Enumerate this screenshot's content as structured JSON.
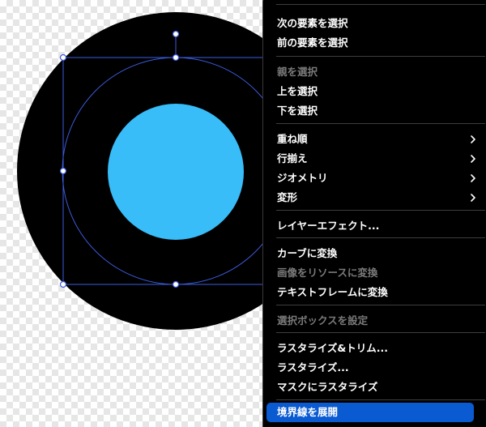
{
  "canvas": {
    "outer_circle_color": "#000000",
    "inner_circle_color": "#38bdf8",
    "selection_color": "#3b5bdb"
  },
  "context_menu": {
    "groups": [
      [
        {
          "label": "次の要素を選択",
          "enabled": true
        },
        {
          "label": "前の要素を選択",
          "enabled": true
        }
      ],
      [
        {
          "label": "親を選択",
          "enabled": false
        },
        {
          "label": "上を選択",
          "enabled": true
        },
        {
          "label": "下を選択",
          "enabled": true
        }
      ],
      [
        {
          "label": "重ね順",
          "enabled": true,
          "submenu": true
        },
        {
          "label": "行揃え",
          "enabled": true,
          "submenu": true
        },
        {
          "label": "ジオメトリ",
          "enabled": true,
          "submenu": true
        },
        {
          "label": "変形",
          "enabled": true,
          "submenu": true
        }
      ],
      [
        {
          "label": "レイヤーエフェクト...",
          "enabled": true
        }
      ],
      [
        {
          "label": "カーブに変換",
          "enabled": true
        },
        {
          "label": "画像をリソースに変換",
          "enabled": false
        },
        {
          "label": "テキストフレームに変換",
          "enabled": true
        }
      ],
      [
        {
          "label": "選択ボックスを設定",
          "enabled": false
        }
      ],
      [
        {
          "label": "ラスタライズ&トリム...",
          "enabled": true
        },
        {
          "label": "ラスタライズ...",
          "enabled": true
        },
        {
          "label": "マスクにラスタライズ",
          "enabled": true
        }
      ],
      [
        {
          "label": "境界線を展開",
          "enabled": true,
          "highlighted": true
        }
      ]
    ]
  }
}
